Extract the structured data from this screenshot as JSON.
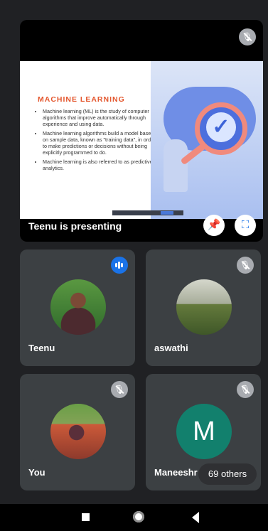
{
  "presentation": {
    "presenting_text": "Teenu is presenting",
    "slide_title": "MACHINE LEARNING",
    "slide_bullets": [
      "Machine learning (ML) is the study of computer algorithms that improve automatically through experience and using data.",
      "Machine learning algorithms build a model based on sample data, known as \"training data\", in order to make predictions or decisions without being explicitly programmed to do.",
      "Machine learning is also referred to as predictive analytics."
    ]
  },
  "participants": {
    "teenu": "Teenu",
    "aswathi": "aswathi",
    "you": "You",
    "maneesh": "Maneeshr",
    "maneesh_initial": "M",
    "others": "69 others"
  },
  "icons": {
    "mic_off": "microphone-off",
    "pin": "pin",
    "fullscreen": "fullscreen",
    "speaking": "audio-level",
    "nav_recents": "square",
    "nav_home": "circle",
    "nav_back": "triangle"
  },
  "colors": {
    "accent_blue": "#1a73e8",
    "avatar_green": "#12806d",
    "tile_bg": "#3c4043"
  }
}
